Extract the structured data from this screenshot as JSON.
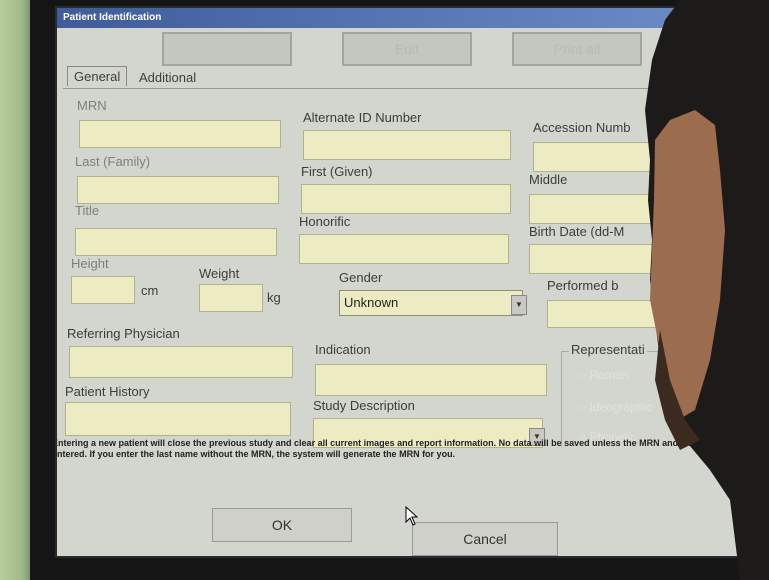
{
  "window": {
    "title": "Patient Identification"
  },
  "tabs": [
    {
      "label": "General"
    },
    {
      "label": "Additional"
    }
  ],
  "top_buttons": [
    {
      "label": ""
    },
    {
      "label": "Edit"
    },
    {
      "label": "Print all"
    }
  ],
  "labels": {
    "mrn": "MRN",
    "alternate_id": "Alternate ID Number",
    "accession": "Accession Numb",
    "last": "Last (Family)",
    "first": "First (Given)",
    "middle": "Middle",
    "title": "Title",
    "honorific": "Honorific",
    "birth_date": "Birth Date (dd-M",
    "height": "Height",
    "height_unit": "cm",
    "weight": "Weight",
    "weight_unit": "kg",
    "gender": "Gender",
    "performed_by": "Performed b",
    "referring_physician": "Referring Physician",
    "indication": "Indication",
    "patient_history": "Patient History",
    "study_description": "Study Description",
    "representation": "Representati"
  },
  "gender": {
    "value": "Unknown"
  },
  "representation_options": [
    "Roman",
    "Ideographic",
    "Phonetic"
  ],
  "note": "Entering a new patient will close the previous study and clear all current images and report information. No data will be saved unless the MRN and last name are entered. If you enter the last name without the MRN, the system will generate the MRN for you.",
  "buttons": {
    "ok": "OK",
    "cancel": "Cancel"
  }
}
